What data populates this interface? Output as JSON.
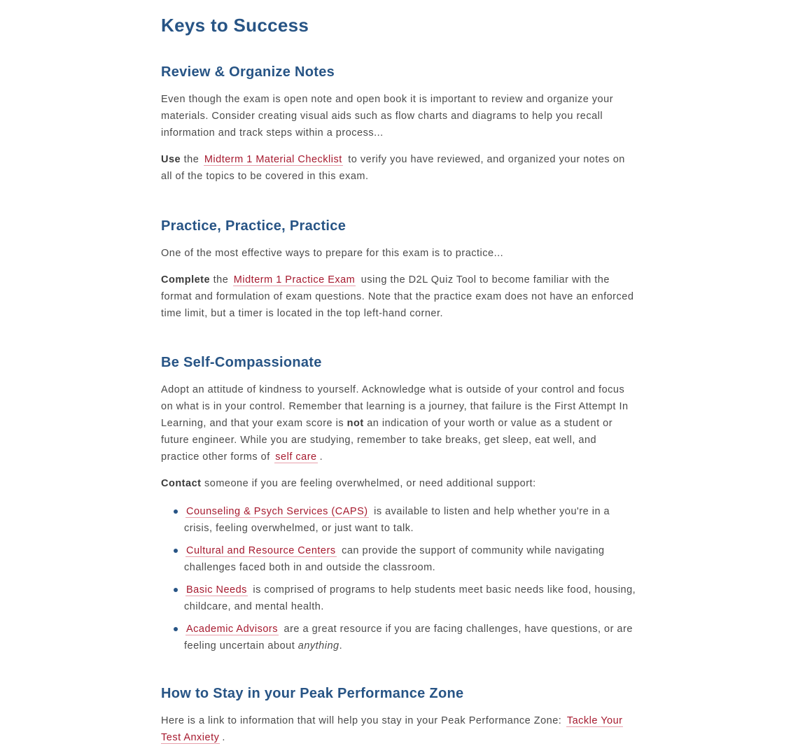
{
  "page": {
    "title": "Keys to Success"
  },
  "sections": {
    "review": {
      "heading": "Review & Organize Notes",
      "paragraph1": "Even though the exam is open note and open book it is important to review and organize your materials. Consider creating visual aids such as flow charts and diagrams to help you recall information and track steps within a process...",
      "p2_bold": "Use",
      "p2_pre": " the ",
      "p2_link": "Midterm 1 Material Checklist",
      "p2_post": " to verify you have reviewed, and organized your notes on all of the topics to be covered in this exam."
    },
    "practice": {
      "heading": "Practice, Practice, Practice",
      "paragraph1": "One of the most effective ways to prepare for this exam is to practice...",
      "p2_bold": "Complete",
      "p2_pre": " the ",
      "p2_link": "Midterm 1 Practice Exam",
      "p2_post": " using the D2L Quiz Tool to become familiar with the format and formulation of exam questions. Note that the practice exam does not have an enforced time limit, but a timer is located in the top left-hand corner."
    },
    "self": {
      "heading": "Be Self-Compassionate",
      "p1_a": "Adopt an attitude of kindness to yourself. Acknowledge what is outside of your control and focus on what is in your control. Remember that learning is a journey, that failure is the First Attempt In Learning, and that your exam score is ",
      "p1_bold": "not",
      "p1_b": " an indication of your worth or value as a student or future engineer. While you are studying, remember to take breaks, get sleep, eat well, and practice other forms of ",
      "p1_link": "self care",
      "p1_end": ".",
      "p2_bold": "Contact",
      "p2_text": " someone if you are feeling overwhelmed, or need additional support:",
      "list": [
        {
          "link": "Counseling & Psych Services (CAPS)",
          "text": " is available to listen and help whether you're in a crisis, feeling overwhelmed, or just want to talk."
        },
        {
          "link": "Cultural and Resource Centers",
          "text": " can provide the support of community while navigating challenges faced both in and outside the classroom."
        },
        {
          "link": "Basic Needs",
          "text": " is comprised of programs to help students meet basic needs like food, housing, childcare, and mental health."
        },
        {
          "link": "Academic Advisors",
          "text": " are a great resource if you are facing challenges, have questions, or are feeling uncertain about ",
          "italic": "anything",
          "end": "."
        }
      ]
    },
    "peak": {
      "heading": "How to Stay in your Peak Performance Zone",
      "p1_text": "Here is a link to information that will help you stay in your Peak Performance Zone: ",
      "p1_link": "Tackle Your Test Anxiety",
      "p1_end": "."
    }
  },
  "colors": {
    "heading": "#275485",
    "link": "#a6192e",
    "body_text": "#4a4a4a"
  }
}
